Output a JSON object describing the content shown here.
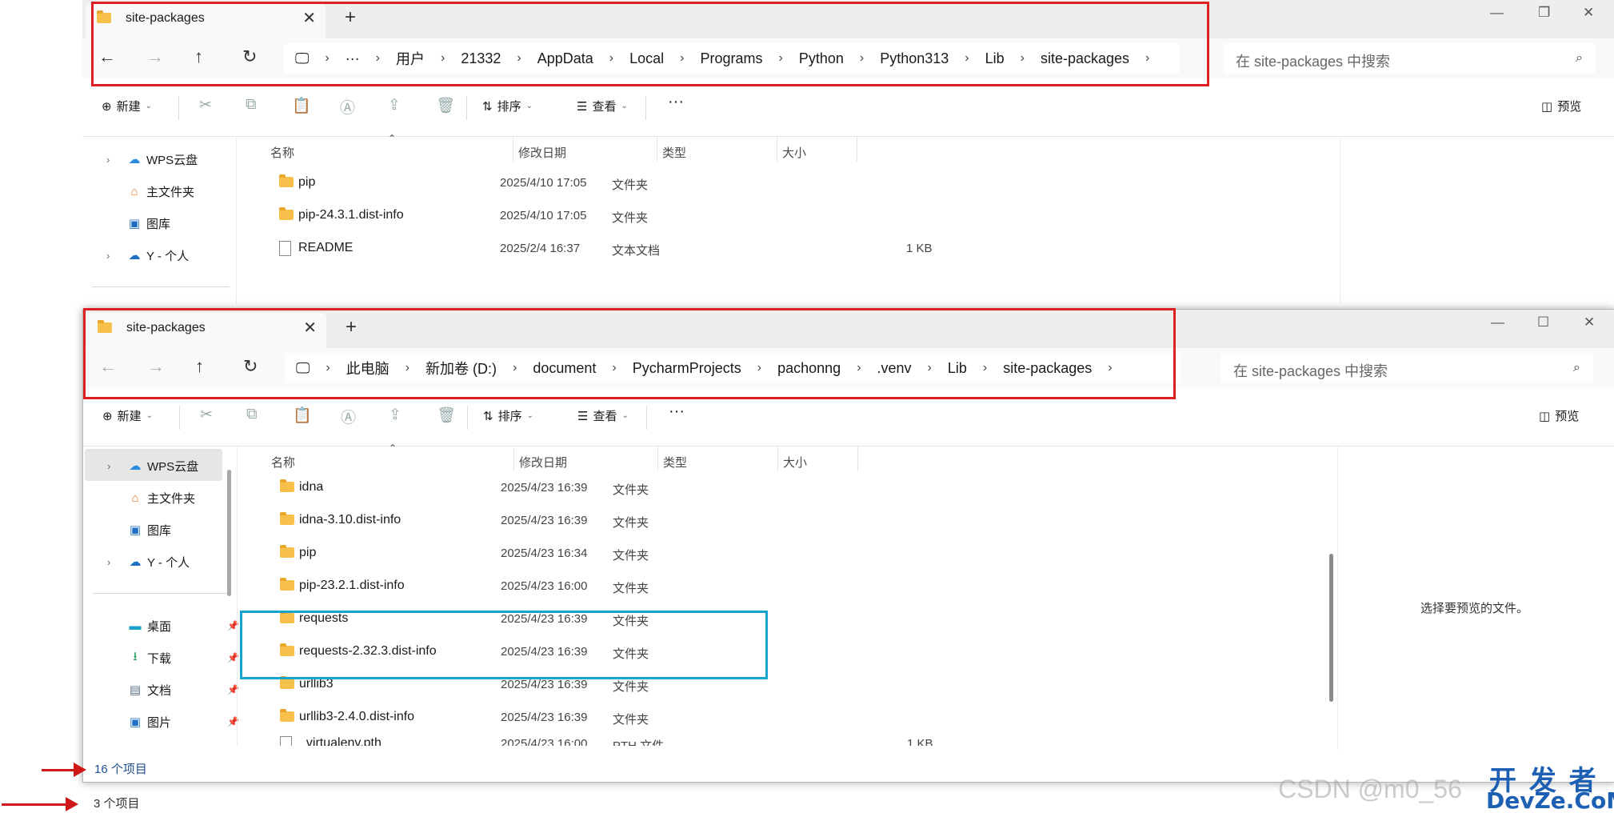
{
  "colors": {
    "highlight_red": "#e02020",
    "highlight_blue": "#17a5cf",
    "folder": "#f7c04a"
  },
  "top_window": {
    "tab_title": "site-packages",
    "breadcrumbs": [
      "用户",
      "21332",
      "AppData",
      "Local",
      "Programs",
      "Python",
      "Python313",
      "Lib",
      "site-packages"
    ],
    "ellipsis": "···",
    "search_placeholder": "在 site-packages 中搜索",
    "toolbar": {
      "new": "新建",
      "sort": "排序",
      "view": "查看",
      "more": "···",
      "preview": "预览"
    },
    "sidebar": [
      {
        "label": "WPS云盘",
        "icon": "cloud-icon"
      },
      {
        "label": "主文件夹",
        "icon": "home-icon"
      },
      {
        "label": "图库",
        "icon": "gallery-icon"
      },
      {
        "label": "Y - 个人",
        "icon": "onedrive-icon"
      }
    ],
    "columns": {
      "name": "名称",
      "date": "修改日期",
      "type": "类型",
      "size": "大小"
    },
    "files": [
      {
        "name": "pip",
        "date": "2025/4/10 17:05",
        "type": "文件夹",
        "size": "",
        "kind": "folder"
      },
      {
        "name": "pip-24.3.1.dist-info",
        "date": "2025/4/10 17:05",
        "type": "文件夹",
        "size": "",
        "kind": "folder"
      },
      {
        "name": "README",
        "date": "2025/2/4 16:37",
        "type": "文本文档",
        "size": "1 KB",
        "kind": "doc"
      }
    ],
    "status": "3 个项目"
  },
  "bottom_window": {
    "tab_title": "site-packages",
    "breadcrumbs": [
      "此电脑",
      "新加卷 (D:)",
      "document",
      "PycharmProjects",
      "pachonng",
      ".venv",
      "Lib",
      "site-packages"
    ],
    "search_placeholder": "在 site-packages 中搜索",
    "toolbar": {
      "new": "新建",
      "sort": "排序",
      "view": "查看",
      "more": "···",
      "preview": "预览"
    },
    "sidebar": [
      {
        "label": "WPS云盘",
        "icon": "cloud-icon"
      },
      {
        "label": "主文件夹",
        "icon": "home-icon"
      },
      {
        "label": "图库",
        "icon": "gallery-icon"
      },
      {
        "label": "Y - 个人",
        "icon": "onedrive-icon"
      },
      {
        "label": "桌面",
        "icon": "desktop-icon"
      },
      {
        "label": "下载",
        "icon": "download-icon"
      },
      {
        "label": "文档",
        "icon": "document-icon"
      },
      {
        "label": "图片",
        "icon": "pictures-icon"
      }
    ],
    "columns": {
      "name": "名称",
      "date": "修改日期",
      "type": "类型",
      "size": "大小"
    },
    "files": [
      {
        "name": "idna",
        "date": "2025/4/23 16:39",
        "type": "文件夹",
        "size": "",
        "kind": "folder"
      },
      {
        "name": "idna-3.10.dist-info",
        "date": "2025/4/23 16:39",
        "type": "文件夹",
        "size": "",
        "kind": "folder"
      },
      {
        "name": "pip",
        "date": "2025/4/23 16:34",
        "type": "文件夹",
        "size": "",
        "kind": "folder"
      },
      {
        "name": "pip-23.2.1.dist-info",
        "date": "2025/4/23 16:00",
        "type": "文件夹",
        "size": "",
        "kind": "folder"
      },
      {
        "name": "requests",
        "date": "2025/4/23 16:39",
        "type": "文件夹",
        "size": "",
        "kind": "folder"
      },
      {
        "name": "requests-2.32.3.dist-info",
        "date": "2025/4/23 16:39",
        "type": "文件夹",
        "size": "",
        "kind": "folder"
      },
      {
        "name": "urllib3",
        "date": "2025/4/23 16:39",
        "type": "文件夹",
        "size": "",
        "kind": "folder"
      },
      {
        "name": "urllib3-2.4.0.dist-info",
        "date": "2025/4/23 16:39",
        "type": "文件夹",
        "size": "",
        "kind": "folder"
      },
      {
        "name": "_virtualenv.pth",
        "date": "2025/4/23 16:00",
        "type": "PTH 文件",
        "size": "1 KB",
        "kind": "doc"
      }
    ],
    "preview_message": "选择要预览的文件。",
    "status": "16 个项目"
  },
  "watermark": {
    "text": "CSDN @m0_56",
    "brand_top": "开 发 者",
    "brand_bottom": "DevZe.CoM"
  }
}
